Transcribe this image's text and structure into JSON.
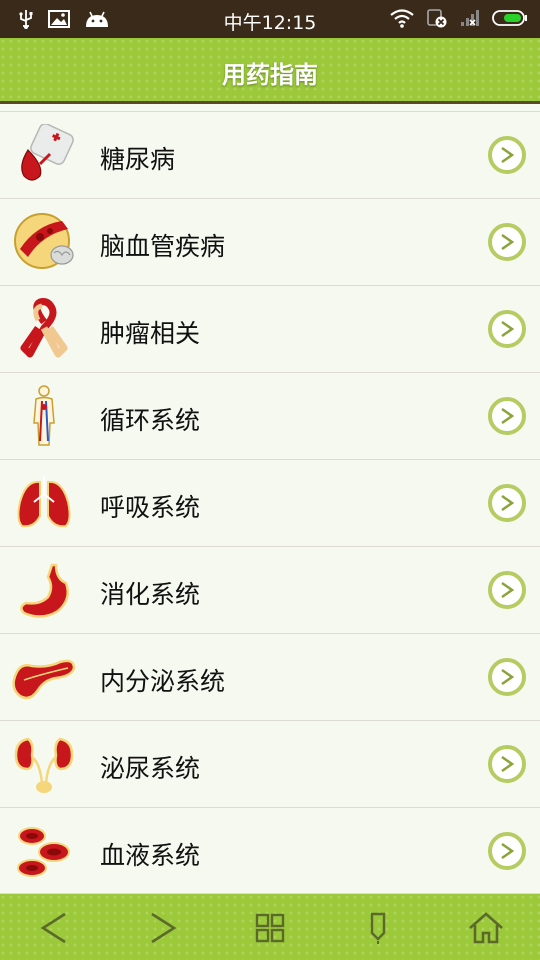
{
  "status_bar": {
    "time": "中午12:15",
    "icons_left": [
      "usb-icon",
      "image-icon",
      "android-icon"
    ],
    "icons_right": [
      "wifi-icon",
      "sim-icon",
      "signal-icon",
      "battery-icon"
    ]
  },
  "header": {
    "title": "用药指南"
  },
  "list": {
    "items": [
      {
        "label": "糖尿病",
        "icon": "blood-drop-icon"
      },
      {
        "label": "脑血管疾病",
        "icon": "blood-vessel-icon"
      },
      {
        "label": "肿瘤相关",
        "icon": "ribbon-icon"
      },
      {
        "label": "循环系统",
        "icon": "body-circulation-icon"
      },
      {
        "label": "呼吸系统",
        "icon": "lungs-icon"
      },
      {
        "label": "消化系统",
        "icon": "stomach-icon"
      },
      {
        "label": "内分泌系统",
        "icon": "pancreas-icon"
      },
      {
        "label": "泌尿系统",
        "icon": "kidneys-icon"
      },
      {
        "label": "血液系统",
        "icon": "blood-cells-icon"
      }
    ]
  },
  "bottom_nav": {
    "buttons": [
      "back-icon",
      "forward-icon",
      "grid-icon",
      "bookmark-icon",
      "home-icon"
    ]
  },
  "colors": {
    "header_green": "#9bc93a",
    "arrow_ring": "#b5cc62",
    "status_bar_bg": "#3a2a1a",
    "organ_red": "#c8161d"
  }
}
